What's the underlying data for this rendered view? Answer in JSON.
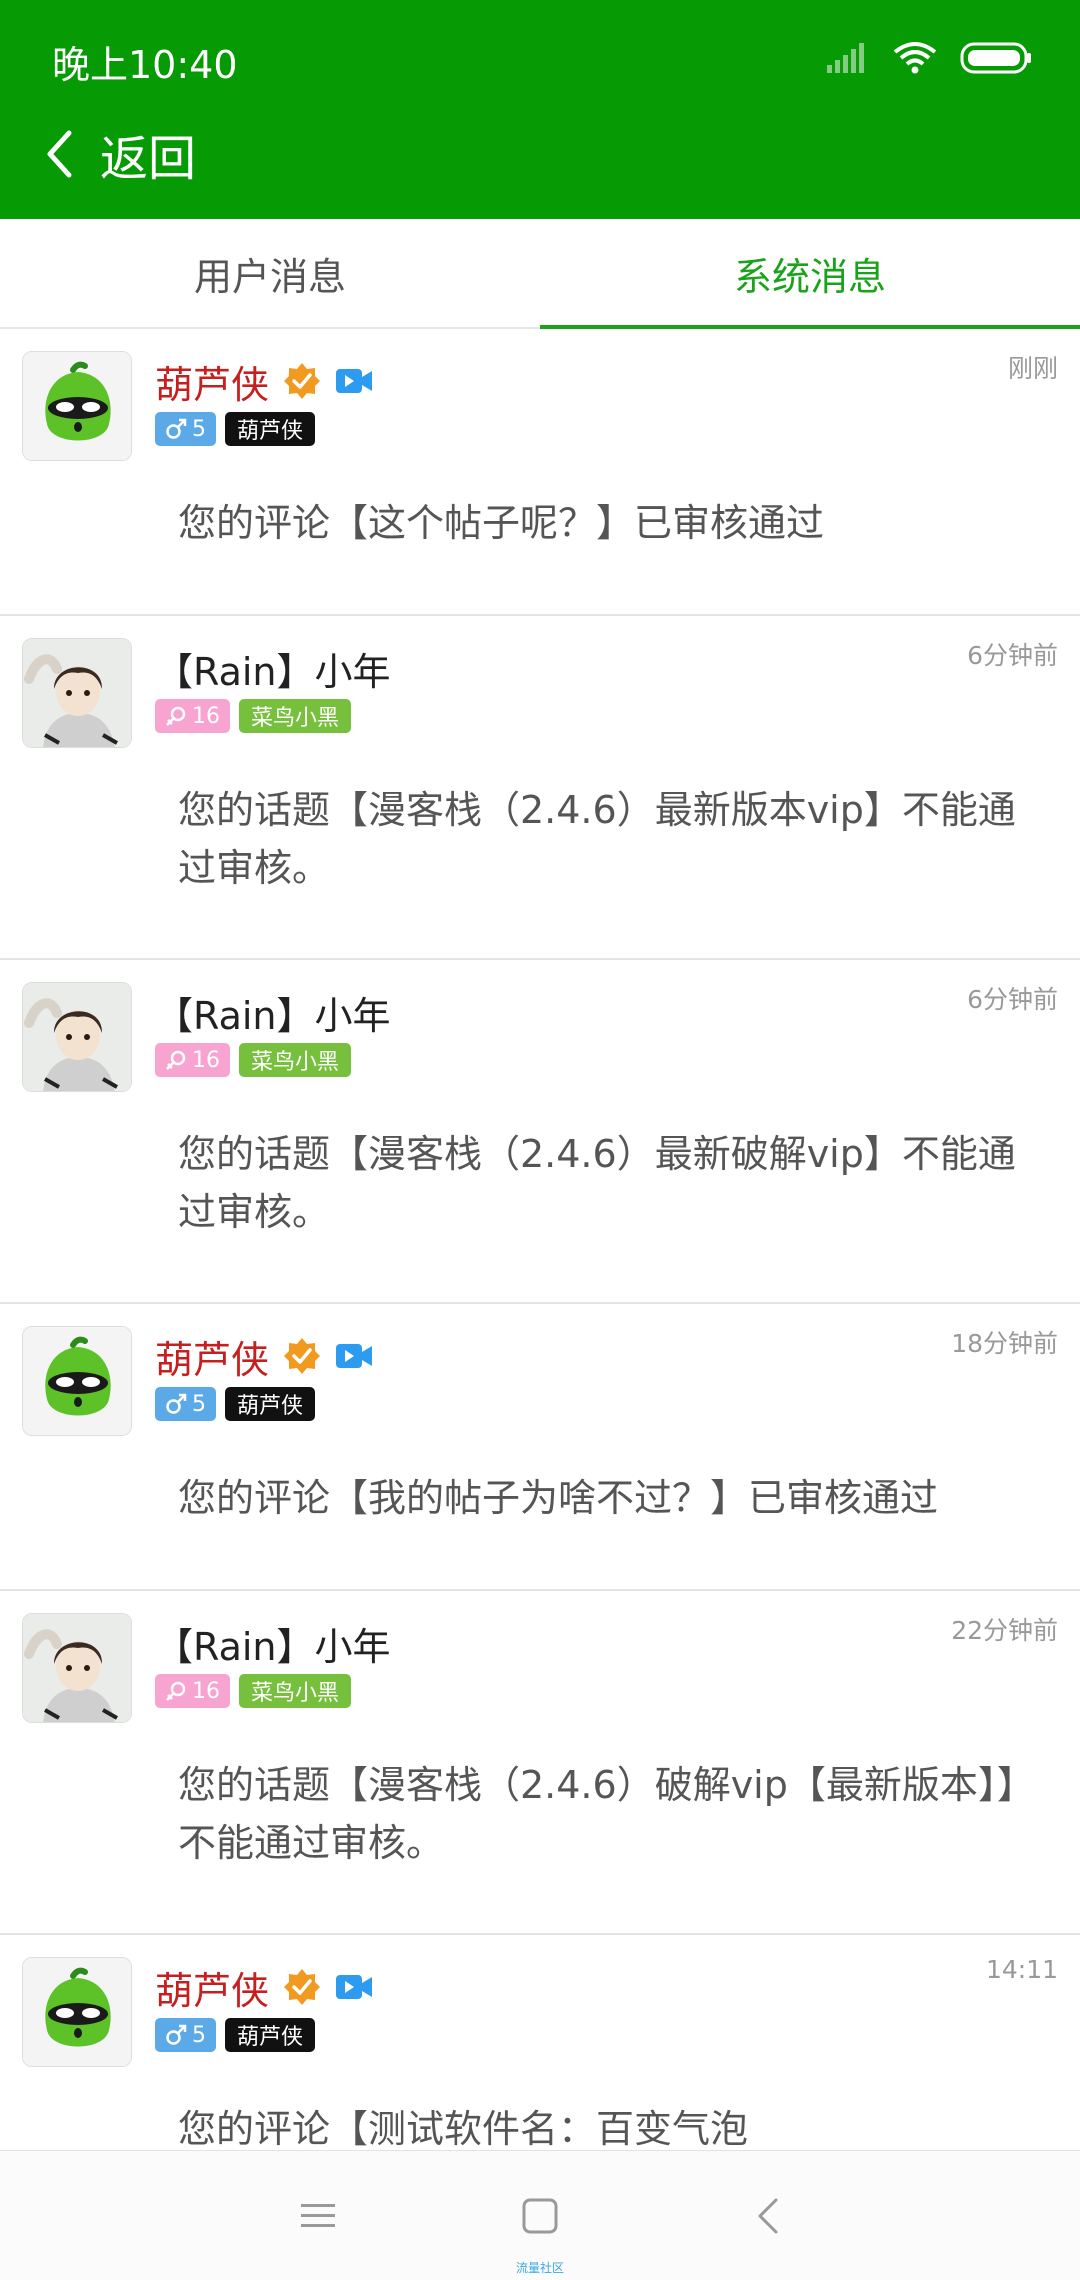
{
  "status_bar": {
    "time": "晚上10:40"
  },
  "header": {
    "back_label": "返回"
  },
  "tabs": [
    {
      "label": "用户消息",
      "active": false
    },
    {
      "label": "系统消息",
      "active": true
    }
  ],
  "messages": [
    {
      "name": "葫芦侠",
      "level": "5",
      "gender": "male",
      "title": "葫芦侠",
      "time": "刚刚",
      "content": "您的评论【这个帖子呢？】已审核通过"
    },
    {
      "name": "【Rain】小年",
      "level": "16",
      "gender": "female",
      "title": "菜鸟小黑",
      "time": "6分钟前",
      "content": "您的话题【漫客栈（2.4.6）最新版本vip】不能通过审核。"
    },
    {
      "name": "【Rain】小年",
      "level": "16",
      "gender": "female",
      "title": "菜鸟小黑",
      "time": "6分钟前",
      "content": "您的话题【漫客栈（2.4.6）最新破解vip】不能通过审核。"
    },
    {
      "name": "葫芦侠",
      "level": "5",
      "gender": "male",
      "title": "葫芦侠",
      "time": "18分钟前",
      "content": "您的评论【我的帖子为啥不过？】已审核通过"
    },
    {
      "name": "【Rain】小年",
      "level": "16",
      "gender": "female",
      "title": "菜鸟小黑",
      "time": "22分钟前",
      "content": "您的话题【漫客栈（2.4.6）破解vip【最新版本】】不能通过审核。"
    },
    {
      "name": "葫芦侠",
      "level": "5",
      "gender": "male",
      "title": "葫芦侠",
      "time": "14:11",
      "content": "您的评论【测试软件名：百变气泡"
    }
  ],
  "navbar": {
    "caption": "流量社区"
  },
  "colors": {
    "header_green": "#069a05",
    "tab_active": "#1aa31a",
    "name_red": "#c61f1f",
    "male_badge": "#5ba9e6",
    "female_badge": "#f8a4d0",
    "title_black": "#111111",
    "title_green": "#77c03d",
    "verified_orange": "#f29a1f",
    "video_blue": "#2d9cf0"
  }
}
